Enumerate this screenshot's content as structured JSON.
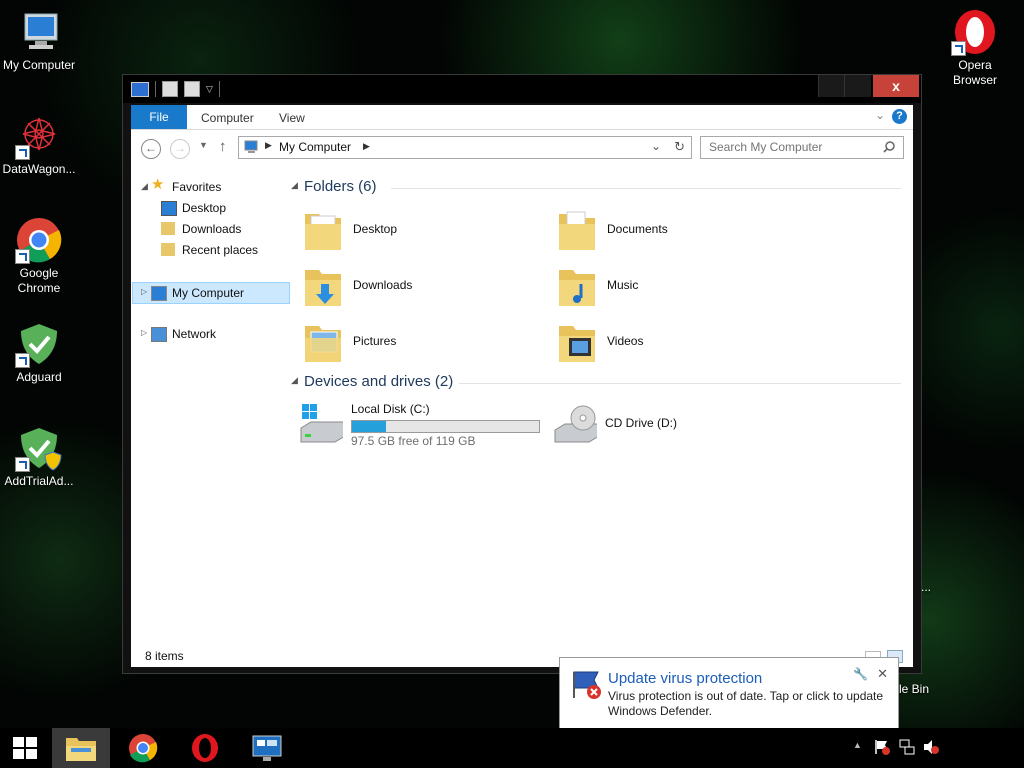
{
  "desktop": {
    "icons": [
      {
        "label": "My Computer"
      },
      {
        "label": "DataWagon..."
      },
      {
        "label": "Google\nChrome"
      },
      {
        "label": "Adguard"
      },
      {
        "label": "AddTrialAd..."
      },
      {
        "label": "Opera\nBrowser"
      }
    ],
    "partial_labels": [
      "le Bin",
      "..."
    ]
  },
  "window": {
    "close_glyph": "x",
    "ribbon": {
      "tabs": [
        "File",
        "Computer",
        "View"
      ],
      "help": "?"
    },
    "address": {
      "path": "My Computer"
    },
    "search": {
      "placeholder": "Search My Computer"
    },
    "nav": {
      "favorites": "Favorites",
      "items": [
        "Desktop",
        "Downloads",
        "Recent places"
      ],
      "my_computer": "My Computer",
      "network": "Network"
    },
    "folders_header": "Folders (6)",
    "folders": [
      "Desktop",
      "Documents",
      "Downloads",
      "Music",
      "Pictures",
      "Videos"
    ],
    "devices_header": "Devices and drives (2)",
    "drives": [
      {
        "name": "Local Disk (C:)",
        "free_text": "97.5 GB free of 119 GB",
        "used_fraction": 0.18
      },
      {
        "name": "CD Drive (D:)"
      }
    ],
    "status": "8 items"
  },
  "notification": {
    "title": "Update virus protection",
    "body": "Virus protection is out of date. Tap or click to update Windows Defender."
  },
  "colors": {
    "accent": "#1979ca",
    "close": "#c7433a",
    "drive_bar": "#26a0da"
  }
}
